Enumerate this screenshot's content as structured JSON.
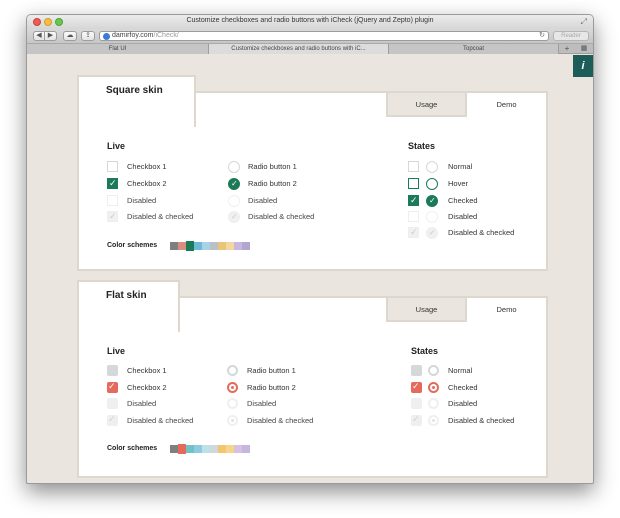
{
  "window": {
    "title": "Customize checkboxes and radio buttons with iCheck (jQuery and Zepto) plugin",
    "address_host": "damirfoy.com",
    "address_path": "/iCheck/",
    "reader_label": "Reader"
  },
  "tabs": [
    {
      "label": "Flat UI"
    },
    {
      "label": "Customize checkboxes and radio buttons with iC..."
    },
    {
      "label": "Topcoat"
    }
  ],
  "square": {
    "title": "Square skin",
    "usage_tab": "Usage",
    "demo_tab": "Demo",
    "live_heading": "Live",
    "states_heading": "States",
    "checkboxes": [
      "Checkbox 1",
      "Checkbox 2",
      "Disabled",
      "Disabled & checked"
    ],
    "radios": [
      "Radio button 1",
      "Radio button 2",
      "Disabled",
      "Disabled & checked"
    ],
    "states": [
      "Normal",
      "Hover",
      "Checked",
      "Disabled",
      "Disabled & checked"
    ],
    "color_schemes_label": "Color schemes",
    "swatch_colors": [
      "#7f7f7f",
      "#d98e7e",
      "#1b7a58",
      "#6fb9d8",
      "#a9d2e6",
      "#bac0c6",
      "#e9c57a",
      "#f6d6a0",
      "#c9b6dc",
      "#b1a6cf"
    ]
  },
  "flat": {
    "title": "Flat skin",
    "usage_tab": "Usage",
    "demo_tab": "Demo",
    "live_heading": "Live",
    "states_heading": "States",
    "checkboxes": [
      "Checkbox 1",
      "Checkbox 2",
      "Disabled",
      "Disabled & checked"
    ],
    "radios": [
      "Radio button 1",
      "Radio button 2",
      "Disabled",
      "Disabled & checked"
    ],
    "states": [
      "Normal",
      "Checked",
      "Disabled",
      "Disabled & checked"
    ],
    "color_schemes_label": "Color schemes",
    "swatch_colors": [
      "#7f7f7f",
      "#e46b5c",
      "#6fc3c5",
      "#8ccbe0",
      "#bfe0e6",
      "#cfd8dc",
      "#f3c56c",
      "#f6d48a",
      "#d7c1e3",
      "#c4b6de"
    ]
  },
  "colors": {
    "square_accent": "#1b7a58",
    "flat_accent": "#e46b5c",
    "page_bg": "#eae6df"
  }
}
